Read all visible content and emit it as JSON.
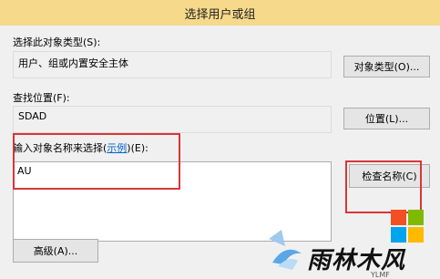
{
  "window": {
    "title": "选择用户或组"
  },
  "object_type": {
    "label": "选择此对象类型",
    "accel": "(S):",
    "value": "用户、组或内置安全主体",
    "button": "对象类型(O)..."
  },
  "location": {
    "label": "查找位置",
    "accel": "(F):",
    "value": "SDAD",
    "button": "位置(L)..."
  },
  "names": {
    "label": "输入对象名称来选择",
    "paren_open": "(",
    "example_link": "示例",
    "paren_close": ")",
    "accel": "(E):",
    "value": "AU",
    "button": "检查名称(C)"
  },
  "advanced": {
    "button": "高级(A)..."
  },
  "watermark": {
    "text": "雨林木风",
    "small": "YLMF",
    "colors": [
      "#f25022",
      "#7fba00",
      "#00a4ef",
      "#ffb900"
    ]
  },
  "accent": {
    "highlight": "#d9353a",
    "link": "#0066cc"
  }
}
